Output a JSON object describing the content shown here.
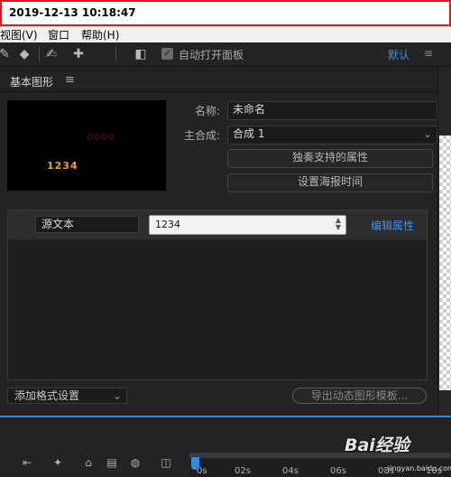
{
  "timestamp": "2019-12-13 10:18:47",
  "menubar": {
    "items": [
      "视图(V)",
      "窗口",
      "帮助(H)"
    ]
  },
  "toolbar": {
    "autoopen_label": "自动打开面板",
    "workspace_label": "默认",
    "workspace_menu": "≡"
  },
  "panel": {
    "title": "基本图形",
    "menu_glyph": "≡",
    "preview_text": "1234",
    "name_label": "名称:",
    "name_value": "未命名",
    "comp_label": "主合成:",
    "comp_value": "合成 1",
    "solo_button": "独奏支持的属性",
    "poster_button": "设置海报时间",
    "property": {
      "name": "源文本",
      "value": "1234",
      "edit_link": "编辑属性"
    },
    "format_select": "添加格式设置",
    "export_button": "导出动态图形模板..."
  },
  "timeline": {
    "ticks": [
      "0s",
      "02s",
      "04s",
      "06s",
      "08s",
      "10s"
    ]
  },
  "watermark": {
    "brand": "Bai经验",
    "url": "jingyan.baidu.com"
  },
  "colors": {
    "accent": "#2d8ceb",
    "link": "#3d8ff0",
    "highlight_border": "#e8101a"
  }
}
